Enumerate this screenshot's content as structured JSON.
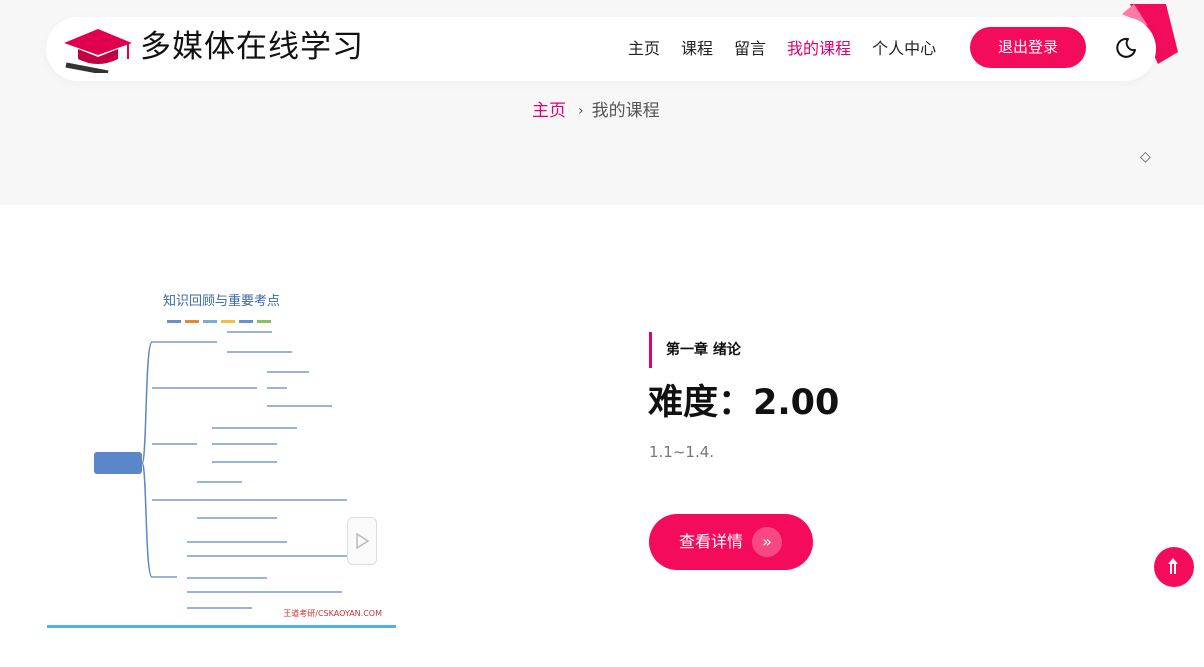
{
  "header": {
    "site_title": "多媒体在线学习",
    "logo_icon": "graduation-cap-icon",
    "nav": [
      {
        "label": "主页",
        "active": false
      },
      {
        "label": "课程",
        "active": false
      },
      {
        "label": "留言",
        "active": false
      },
      {
        "label": "我的课程",
        "active": true
      },
      {
        "label": "个人中心",
        "active": false
      }
    ],
    "logout_label": "退出登录",
    "theme_icon": "moon-icon"
  },
  "breadcrumb": {
    "home": "主页",
    "separator": "›",
    "current": "我的课程"
  },
  "course": {
    "thumbnail_title": "知识回顾与重要考点",
    "thumbnail_watermark": "王道考研/CSKAOYAN.COM",
    "chapter": "第一章 绪论",
    "difficulty": "难度：2.00",
    "description": "1.1~1.4.",
    "details_label": "查看详情",
    "details_icon": "double-chevron-right-icon"
  },
  "colors": {
    "accent": "#f40b5b",
    "active_link": "#e0006e",
    "band": "#f7f7f7"
  }
}
